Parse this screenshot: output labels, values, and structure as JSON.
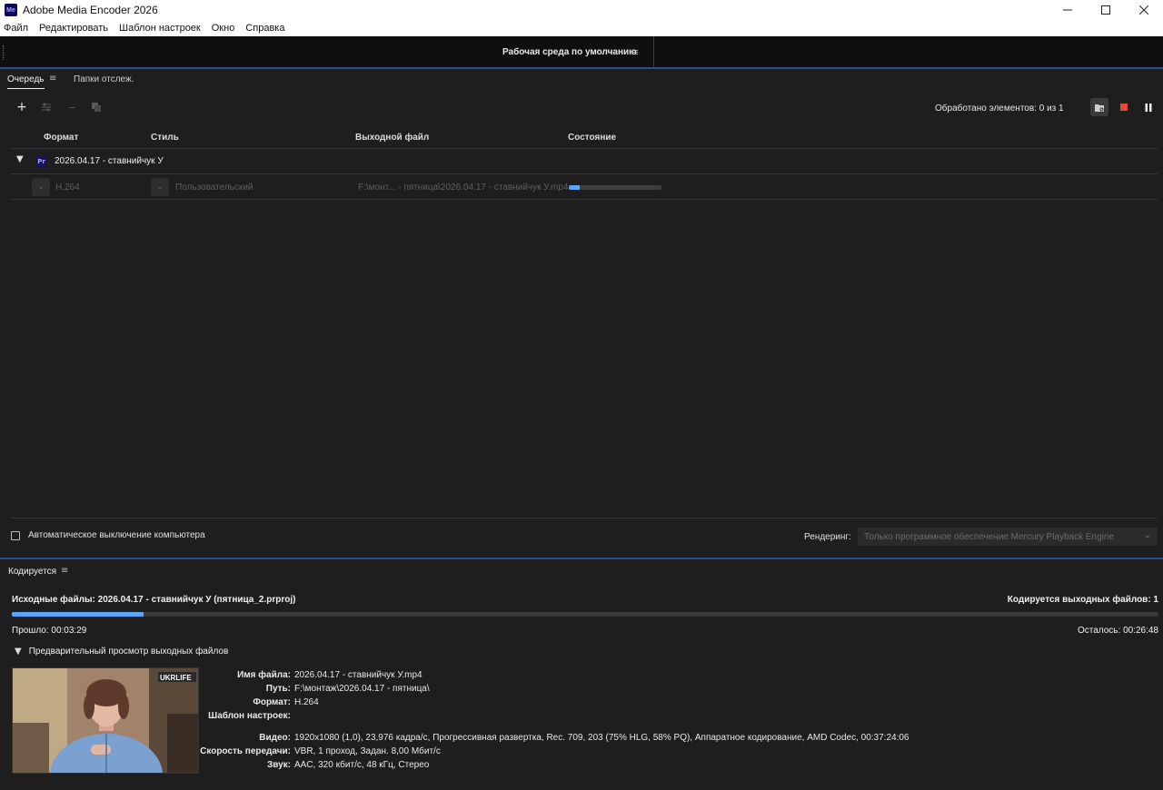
{
  "window": {
    "title": "Adobe Media Encoder 2026",
    "app_icon_text": "Me",
    "controls": [
      "minimize-icon",
      "maximize-icon",
      "close-icon"
    ]
  },
  "menu": [
    "Файл",
    "Редактировать",
    "Шаблон настроек",
    "Окно",
    "Справка"
  ],
  "workspace": {
    "label": "Рабочая среда по умолчанию"
  },
  "queue": {
    "tabs": [
      "Очередь",
      "Папки отслеж."
    ],
    "processed": "Обработано элементов: 0 из 1",
    "columns": {
      "format": "Формат",
      "style": "Стиль",
      "output": "Выходной файл",
      "status": "Состояние"
    },
    "group": {
      "badge": "Pr",
      "name": "2026.04.17 - ставнийчук У"
    },
    "item": {
      "format": "H.264",
      "style": "Пользовательский",
      "output": "F:\\монт...  - пятница\\2026.04.17 - ставнийчук У.mp4",
      "progress": 0.12
    },
    "auto_shutdown": "Автоматическое выключение компьютера",
    "renderer_label": "Рендеринг:",
    "renderer_value": "Только программное обеспечение Mercury Playback Engine"
  },
  "encoding": {
    "tab": "Кодируется",
    "source": "Исходные файлы: 2026.04.17 - ставнийчук У (пятница_2.prproj)",
    "output_count": "Кодируется выходных файлов: 1",
    "progress": 0.115,
    "elapsed": "Прошло: 00:03:29",
    "remaining": "Осталось: 00:26:48",
    "preview_label": "Предварительный просмотр выходных файлов",
    "thumbnail_logo": "UKRLIFE",
    "details": [
      {
        "key": "Имя файла:",
        "value": "2026.04.17 - ставнийчук У.mp4"
      },
      {
        "key": "Путь:",
        "value": "F:\\монтаж\\2026.04.17  - пятница\\"
      },
      {
        "key": "Формат:",
        "value": "H.264"
      },
      {
        "key": "Шаблон настроек:",
        "value": ""
      },
      {
        "key": "Видео:",
        "value": "1920x1080 (1,0), 23,976 кадра/с, Прогрессивная развертка, Rec. 709, 203 (75% HLG, 58% PQ), Аппаратное кодирование, AMD Codec, 00:37:24:06"
      },
      {
        "key": "Скорость передачи:",
        "value": "VBR, 1 проход, Задан. 8,00 Мбит/с"
      },
      {
        "key": "Звук:",
        "value": "AAC, 320 кбит/с, 48 кГц, Стерео"
      }
    ]
  },
  "colors": {
    "accent": "#5aa4ff",
    "panel_border": "#2a4f8a",
    "stop": "#e5493a",
    "bg": "#1e1e1e"
  }
}
